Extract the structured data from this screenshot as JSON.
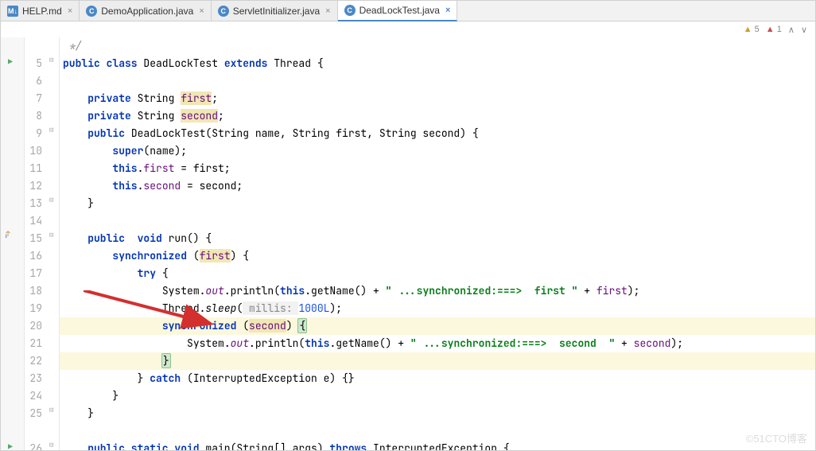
{
  "tabs": [
    {
      "label": "HELP.md",
      "close": "×"
    },
    {
      "label": "DemoApplication.java",
      "close": "×"
    },
    {
      "label": "ServletInitializer.java",
      "close": "×"
    },
    {
      "label": "DeadLockTest.java",
      "close": "×"
    }
  ],
  "info": {
    "warnings": "5",
    "errors": "1"
  },
  "watermark": "©51CTO博客",
  "lines": [
    {
      "num": ""
    },
    {
      "num": "5"
    },
    {
      "num": "6"
    },
    {
      "num": "7"
    },
    {
      "num": "8"
    },
    {
      "num": "9"
    },
    {
      "num": "10"
    },
    {
      "num": "11"
    },
    {
      "num": "12"
    },
    {
      "num": "13"
    },
    {
      "num": "14"
    },
    {
      "num": "15"
    },
    {
      "num": "16"
    },
    {
      "num": "17"
    },
    {
      "num": "18"
    },
    {
      "num": "19"
    },
    {
      "num": "20"
    },
    {
      "num": "21"
    },
    {
      "num": "22"
    },
    {
      "num": "23"
    },
    {
      "num": "24"
    },
    {
      "num": "25"
    },
    {
      "num": ""
    },
    {
      "num": "26"
    }
  ],
  "code": {
    "comment_close": "*/",
    "class_decl": "public class DeadLockTest extends Thread {",
    "field_first": "private String first;",
    "field_second": "private String second;",
    "ctor": "public DeadLockTest(String name, String first, String second) {",
    "super_call": "super(name);",
    "assign_first": "this.first = first;",
    "assign_second": "this.second = second;",
    "run": "public  void run() {",
    "sync_first": "synchronized (first) {",
    "try": "try {",
    "println_first": "System.out.println(this.getName() + \" ...synchronized:===>  first \" + first);",
    "sleep": "Thread.sleep( millis: 1000L);",
    "sync_second": "synchronized (second) {",
    "println_second": "System.out.println(this.getName() + \" ...synchronized:===>  second  \" + second);",
    "catch": "} catch (InterruptedException e) {}",
    "main": "public static void main(String[] args) throws InterruptedException {"
  }
}
